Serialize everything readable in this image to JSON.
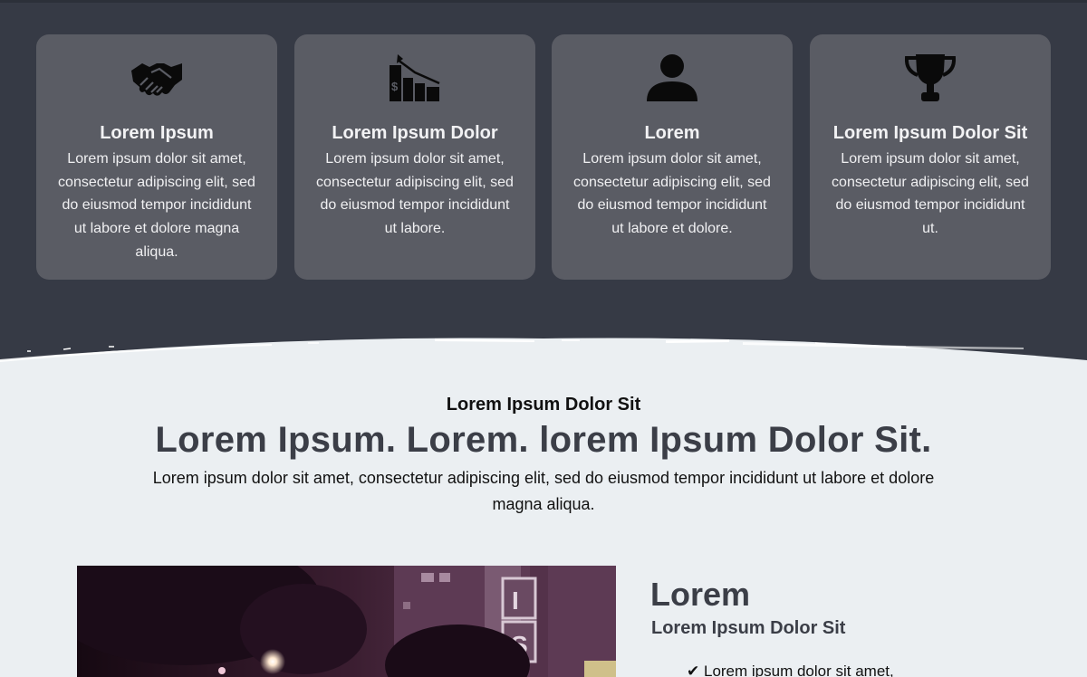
{
  "features": [
    {
      "icon": "handshake-icon",
      "title": "Lorem Ipsum",
      "text": "Lorem ipsum dolor sit amet, consectetur adipiscing elit, sed do eiusmod tempor incididunt ut labore et dolore magna aliqua."
    },
    {
      "icon": "declining-chart-icon",
      "title": "Lorem Ipsum Dolor",
      "text": "Lorem ipsum dolor sit amet, consectetur adipiscing elit, sed do eiusmod tempor incididunt ut labore."
    },
    {
      "icon": "person-icon",
      "title": "Lorem",
      "text": "Lorem ipsum dolor sit amet, consectetur adipiscing elit, sed do eiusmod tempor incididunt ut labore et dolore."
    },
    {
      "icon": "trophy-icon",
      "title": "Lorem Ipsum Dolor Sit",
      "text": "Lorem ipsum dolor sit amet, consectetur adipiscing elit, sed do eiusmod tempor incididunt ut."
    }
  ],
  "intro": {
    "kicker": "Lorem Ipsum Dolor Sit",
    "heading": "Lorem Ipsum. Lorem. lorem Ipsum Dolor Sit.",
    "text": "Lorem ipsum dolor sit amet, consectetur adipiscing elit, sed do eiusmod tempor incididunt ut labore et dolore magna aliqua."
  },
  "side": {
    "heading": "Lorem",
    "subheading": "Lorem Ipsum Dolor Sit",
    "checklist": [
      {
        "mark": "✔",
        "text": "Lorem ipsum dolor sit amet,"
      }
    ]
  },
  "photo": {
    "sign_letters": [
      "I",
      "S"
    ]
  },
  "colors": {
    "dark_background": "#363a45",
    "card_background": "#5a5c64",
    "light_background": "#ebeff2",
    "heading_color": "#3b3e47"
  }
}
